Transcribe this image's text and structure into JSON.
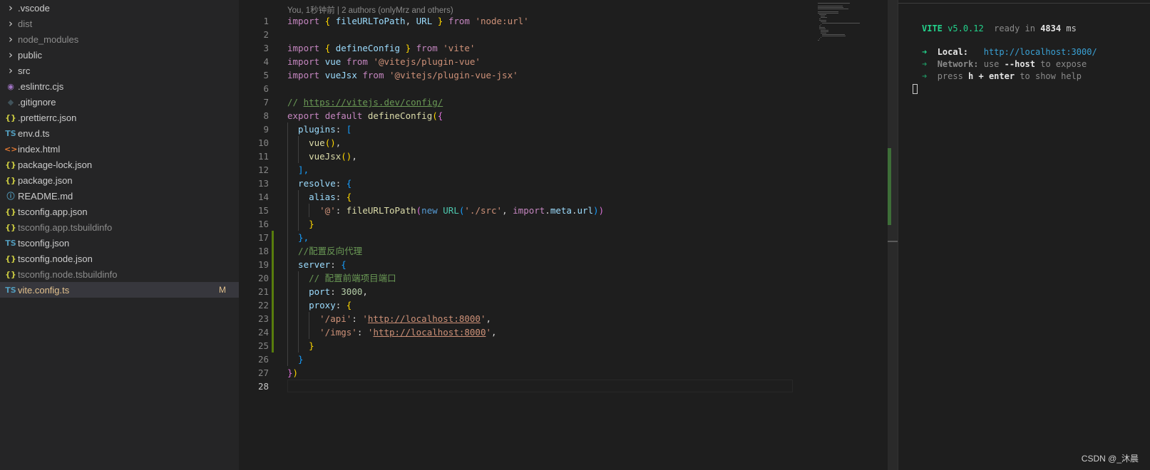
{
  "explorer": {
    "files": [
      {
        "name": ".vscode",
        "type": "folder",
        "icon": "chevron-right-icon",
        "glyph": "›",
        "color": "#cccccc",
        "dim": false
      },
      {
        "name": "dist",
        "type": "folder",
        "icon": "chevron-right-icon",
        "glyph": "›",
        "color": "#cccccc",
        "dim": true
      },
      {
        "name": "node_modules",
        "type": "folder",
        "icon": "chevron-right-icon",
        "glyph": "›",
        "color": "#cccccc",
        "dim": true
      },
      {
        "name": "public",
        "type": "folder",
        "icon": "chevron-right-icon",
        "glyph": "›",
        "color": "#cccccc",
        "dim": false
      },
      {
        "name": "src",
        "type": "folder",
        "icon": "chevron-right-icon",
        "glyph": "›",
        "color": "#cccccc",
        "dim": false
      },
      {
        "name": ".eslintrc.cjs",
        "type": "file",
        "icon": "eslint-icon",
        "glyph": "◉",
        "color": "#a074c4",
        "dim": false
      },
      {
        "name": ".gitignore",
        "type": "file",
        "icon": "git-icon",
        "glyph": "◆",
        "color": "#41535b",
        "dim": false
      },
      {
        "name": ".prettierrc.json",
        "type": "file",
        "icon": "json-icon",
        "glyph": "{}",
        "color": "#cbcb41",
        "dim": false
      },
      {
        "name": "env.d.ts",
        "type": "file",
        "icon": "typescript-icon",
        "glyph": "TS",
        "color": "#519aba",
        "dim": false
      },
      {
        "name": "index.html",
        "type": "file",
        "icon": "html-icon",
        "glyph": "<>",
        "color": "#e37933",
        "dim": false
      },
      {
        "name": "package-lock.json",
        "type": "file",
        "icon": "json-icon",
        "glyph": "{}",
        "color": "#cbcb41",
        "dim": false
      },
      {
        "name": "package.json",
        "type": "file",
        "icon": "json-icon",
        "glyph": "{}",
        "color": "#cbcb41",
        "dim": false
      },
      {
        "name": "README.md",
        "type": "file",
        "icon": "info-icon",
        "glyph": "ⓘ",
        "color": "#519aba",
        "dim": false
      },
      {
        "name": "tsconfig.app.json",
        "type": "file",
        "icon": "json-icon",
        "glyph": "{}",
        "color": "#cbcb41",
        "dim": false
      },
      {
        "name": "tsconfig.app.tsbuildinfo",
        "type": "file",
        "icon": "json-icon",
        "glyph": "{}",
        "color": "#cbcb41",
        "dim": true
      },
      {
        "name": "tsconfig.json",
        "type": "file",
        "icon": "tsconfig-icon",
        "glyph": "TS",
        "color": "#519aba",
        "dim": false
      },
      {
        "name": "tsconfig.node.json",
        "type": "file",
        "icon": "json-icon",
        "glyph": "{}",
        "color": "#cbcb41",
        "dim": false
      },
      {
        "name": "tsconfig.node.tsbuildinfo",
        "type": "file",
        "icon": "json-icon",
        "glyph": "{}",
        "color": "#cbcb41",
        "dim": true
      },
      {
        "name": "vite.config.ts",
        "type": "file",
        "icon": "typescript-icon",
        "glyph": "TS",
        "color": "#519aba",
        "dim": false,
        "active": true,
        "modified": true,
        "badge": "M"
      }
    ]
  },
  "editor": {
    "blame": "You, 1秒钟前 | 2 authors (onlyMrz and others)",
    "current_line": 28,
    "git_modified_lines": [
      17,
      18,
      19,
      20,
      21,
      22,
      23,
      24,
      25
    ],
    "lines": [
      [
        [
          "import ",
          "key"
        ],
        [
          "{ ",
          "b1"
        ],
        [
          "fileURLToPath",
          "var"
        ],
        [
          ", ",
          "pun"
        ],
        [
          "URL",
          "var"
        ],
        [
          " } ",
          "b1"
        ],
        [
          "from ",
          "key"
        ],
        [
          "'node:url'",
          "str"
        ]
      ],
      [],
      [
        [
          "import ",
          "key"
        ],
        [
          "{ ",
          "b1"
        ],
        [
          "defineConfig",
          "var"
        ],
        [
          " } ",
          "b1"
        ],
        [
          "from ",
          "key"
        ],
        [
          "'vite'",
          "str"
        ]
      ],
      [
        [
          "import ",
          "key"
        ],
        [
          "vue ",
          "var"
        ],
        [
          "from ",
          "key"
        ],
        [
          "'@vitejs/plugin-vue'",
          "str"
        ]
      ],
      [
        [
          "import ",
          "key"
        ],
        [
          "vueJsx ",
          "var"
        ],
        [
          "from ",
          "key"
        ],
        [
          "'@vitejs/plugin-vue-jsx'",
          "str"
        ]
      ],
      [],
      [
        [
          "// ",
          "com"
        ],
        [
          "https://vitejs.dev/config/",
          "comlink"
        ]
      ],
      [
        [
          "export ",
          "key"
        ],
        [
          "default ",
          "key"
        ],
        [
          "defineConfig",
          "fn"
        ],
        [
          "(",
          "b1"
        ],
        [
          "{",
          "b2"
        ]
      ],
      [
        [
          "  plugins",
          "var"
        ],
        [
          ": ",
          "pun"
        ],
        [
          "[",
          "b3"
        ]
      ],
      [
        [
          "    vue",
          "fn"
        ],
        [
          "()",
          "b1"
        ],
        [
          ",",
          "pun"
        ]
      ],
      [
        [
          "    vueJsx",
          "fn"
        ],
        [
          "()",
          "b1"
        ],
        [
          ",",
          "pun"
        ]
      ],
      [
        [
          "  ],",
          "b3"
        ]
      ],
      [
        [
          "  resolve",
          "var"
        ],
        [
          ": ",
          "pun"
        ],
        [
          "{",
          "b3"
        ]
      ],
      [
        [
          "    alias",
          "var"
        ],
        [
          ": ",
          "pun"
        ],
        [
          "{",
          "b1"
        ]
      ],
      [
        [
          "      '@'",
          "str"
        ],
        [
          ": ",
          "pun"
        ],
        [
          "fileURLToPath",
          "fn"
        ],
        [
          "(",
          "b2"
        ],
        [
          "new ",
          "kw"
        ],
        [
          "URL",
          "cls"
        ],
        [
          "(",
          "b3"
        ],
        [
          "'./src'",
          "str"
        ],
        [
          ", ",
          "pun"
        ],
        [
          "import",
          "key"
        ],
        [
          ".",
          "pun"
        ],
        [
          "meta",
          "var"
        ],
        [
          ".",
          "pun"
        ],
        [
          "url",
          "var"
        ],
        [
          ")",
          "b3"
        ],
        [
          ")",
          "b2"
        ]
      ],
      [
        [
          "    }",
          "b1"
        ]
      ],
      [
        [
          "  },",
          "b3"
        ]
      ],
      [
        [
          "  //配置反向代理",
          "com"
        ]
      ],
      [
        [
          "  server",
          "var"
        ],
        [
          ": ",
          "pun"
        ],
        [
          "{",
          "b3"
        ]
      ],
      [
        [
          "    // 配置前端项目端口",
          "com"
        ]
      ],
      [
        [
          "    port",
          "var"
        ],
        [
          ": ",
          "pun"
        ],
        [
          "3000",
          "num"
        ],
        [
          ",",
          "pun"
        ]
      ],
      [
        [
          "    proxy",
          "var"
        ],
        [
          ": ",
          "pun"
        ],
        [
          "{",
          "b1"
        ]
      ],
      [
        [
          "      '/api'",
          "str"
        ],
        [
          ": ",
          "pun"
        ],
        [
          "'",
          "str"
        ],
        [
          "http://localhost:8000",
          "strlink"
        ],
        [
          "'",
          "str"
        ],
        [
          ",",
          "pun"
        ]
      ],
      [
        [
          "      '/imgs'",
          "str"
        ],
        [
          ": ",
          "pun"
        ],
        [
          "'",
          "str"
        ],
        [
          "http://localhost:8000",
          "strlink"
        ],
        [
          "'",
          "str"
        ],
        [
          ",",
          "pun"
        ]
      ],
      [
        [
          "    }",
          "b1"
        ]
      ],
      [
        [
          "  }",
          "b3"
        ]
      ],
      [
        [
          "}",
          "b2"
        ],
        [
          ")",
          "b1"
        ]
      ],
      []
    ]
  },
  "terminal": {
    "vite_name": "VITE",
    "vite_version": "v5.0.12",
    "ready_text": "ready in",
    "ready_ms": "4834",
    "ms_unit": "ms",
    "arrow": "➜",
    "local_label": "Local:",
    "local_url": "http://localhost:3000/",
    "network_label": "Network:",
    "network_use": "use",
    "network_flag": "--host",
    "network_expose": "to expose",
    "press": "press",
    "press_key": "h + enter",
    "press_rest": "to show help"
  },
  "watermark": "CSDN @_沐晨"
}
